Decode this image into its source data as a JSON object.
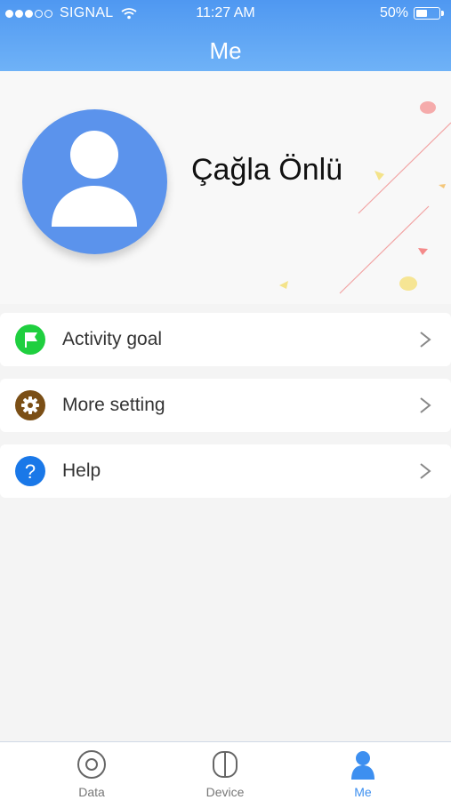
{
  "status_bar": {
    "carrier": "SIGNAL",
    "time": "11:27 AM",
    "battery_percent": "50%",
    "battery_level": 0.5
  },
  "header": {
    "title": "Me"
  },
  "profile": {
    "name": "Çağla Önlü"
  },
  "menu": [
    {
      "label": "Activity goal",
      "icon": "flag-icon",
      "color": "#1fcf3f"
    },
    {
      "label": "More setting",
      "icon": "gear-icon",
      "color": "#7b4f16"
    },
    {
      "label": "Help",
      "icon": "help-icon",
      "color": "#1a78e8"
    }
  ],
  "tabs": [
    {
      "label": "Data",
      "icon": "data-icon",
      "active": false
    },
    {
      "label": "Device",
      "icon": "device-icon",
      "active": false
    },
    {
      "label": "Me",
      "icon": "person-icon",
      "active": true
    }
  ],
  "colors": {
    "accent": "#3d8ff0",
    "header_bg": "#5aa3f3"
  }
}
